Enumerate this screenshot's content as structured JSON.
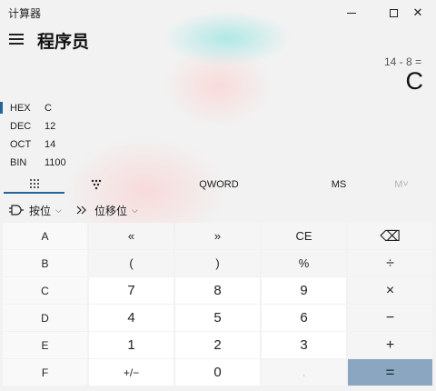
{
  "window": {
    "title": "计算器",
    "minimize": "—",
    "close": "✕"
  },
  "header": {
    "mode": "程序员"
  },
  "display": {
    "expression": "14 - 8 =",
    "result": "C"
  },
  "radix": [
    {
      "label": "HEX",
      "value": "C",
      "selected": true
    },
    {
      "label": "DEC",
      "value": "12",
      "selected": false
    },
    {
      "label": "OCT",
      "value": "14",
      "selected": false
    },
    {
      "label": "BIN",
      "value": "1100",
      "selected": false
    }
  ],
  "tabs": {
    "keypad_icon": "keypad-grid-icon",
    "bitflip_icon": "bit-toggle-icon",
    "word_size": "QWORD",
    "memory_store": "MS",
    "memory_list": "M˅"
  },
  "operators": {
    "bitwise": "按位",
    "bitwise_chevron": "⌵",
    "bitshift": "位移位",
    "bitshift_chevron": "⌵"
  },
  "keypad": {
    "rows": [
      [
        "A",
        "«",
        "»",
        "CE",
        "⌫"
      ],
      [
        "B",
        "(",
        ")",
        "%",
        "÷"
      ],
      [
        "C",
        "7",
        "8",
        "9",
        "×"
      ],
      [
        "D",
        "4",
        "5",
        "6",
        "−"
      ],
      [
        "E",
        "1",
        "2",
        "3",
        "+"
      ],
      [
        "F",
        "+/−",
        "0",
        ".",
        "="
      ]
    ]
  },
  "colors": {
    "accent": "#26639a",
    "equals_bg": "#8ba6c1",
    "background": "#f2f2f2"
  }
}
